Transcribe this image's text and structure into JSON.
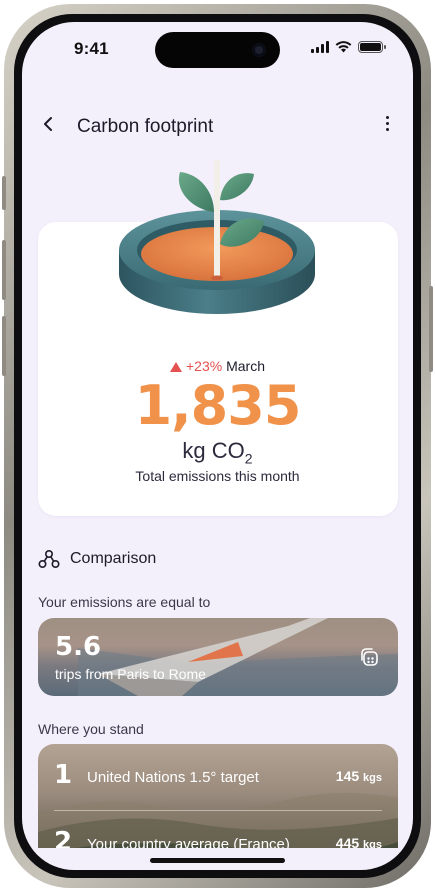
{
  "status": {
    "time": "9:41"
  },
  "header": {
    "title": "Carbon footprint"
  },
  "summary": {
    "change": "+23%",
    "month": "March",
    "value": "1,835",
    "unit": "kg CO",
    "unit_sub": "2",
    "caption": "Total emissions this month"
  },
  "comparison": {
    "title": "Comparison",
    "equal_label": "Your emissions are equal to",
    "trip_value": "5.6",
    "trip_text": "trips from Paris to Rome",
    "stand_label": "Where you stand",
    "rows": [
      {
        "rank": "1",
        "name": "United Nations 1.5° target",
        "value": "145",
        "unit": "kgs"
      },
      {
        "rank": "2",
        "name": "Your country average (France)",
        "value": "445",
        "unit": "kgs"
      }
    ]
  },
  "colors": {
    "accent": "#f0924a",
    "increase": "#e4514f",
    "background": "#f4f0fb"
  }
}
